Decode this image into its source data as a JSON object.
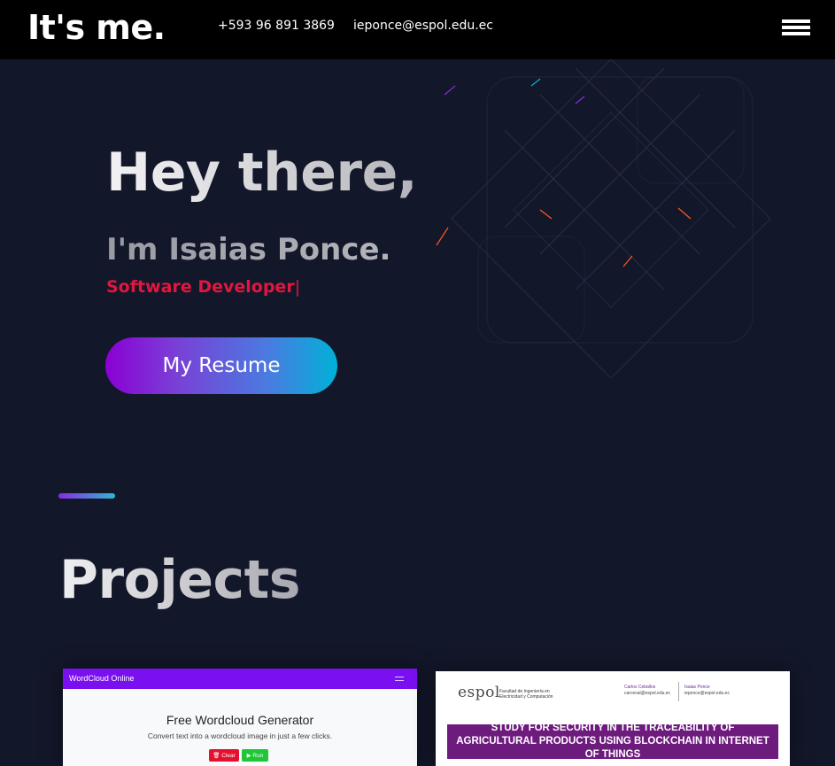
{
  "header": {
    "brand": "It's me.",
    "phone": "+593 96 891 3869",
    "email": "ieponce@espol.edu.ec",
    "menu_icon": "hamburger-menu-icon"
  },
  "hero": {
    "greeting": "Hey there,",
    "name": "I'm Isaias Ponce.",
    "role": "Software Developer",
    "caret": "|",
    "resume_button": "My Resume"
  },
  "projects": {
    "title": "Projects",
    "cards": [
      {
        "app_name": "WordCloud Online",
        "heading": "Free Wordcloud Generator",
        "subtitle": "Convert text into a wordcloud image in just a few clicks.",
        "clear_label": "🗑 Clear",
        "run_label": "▶ Run"
      },
      {
        "logo": "espol",
        "faculty": "Facultad de Ingeniería en Electricidad y Computación",
        "authors": [
          {
            "name": "Carlos Ceballos",
            "email": "carceval@espol.edu.ec"
          },
          {
            "name": "Isaias Ponce",
            "email": "ieponce@espol.edu.ec"
          }
        ],
        "title": "STUDY FOR SECURITY IN THE TRACEABILITY OF AGRICULTURAL PRODUCTS USING BLOCKCHAIN IN INTERNET OF THINGS"
      }
    ]
  },
  "colors": {
    "background": "#13172a",
    "topbar": "#000000",
    "role_accent": "#e0173f",
    "gradient_start": "#8a00d4",
    "gradient_end": "#00b1d8",
    "wordcloud_nav": "#7a10f0",
    "paper_band": "#6e1b7e"
  }
}
